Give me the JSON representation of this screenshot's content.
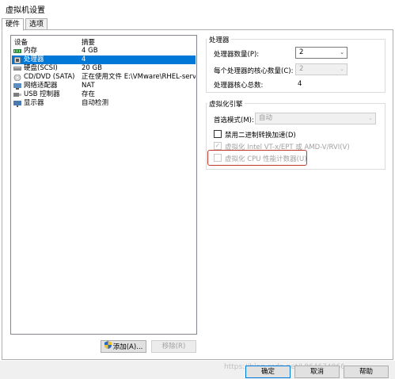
{
  "window": {
    "title": "虚拟机设置"
  },
  "tabs": [
    {
      "label": "硬件",
      "active": true
    },
    {
      "label": "选项",
      "active": false
    }
  ],
  "device_list": {
    "headers": {
      "device": "设备",
      "summary": "摘要"
    },
    "rows": [
      {
        "icon": "memory-icon",
        "name": "内存",
        "value": "4 GB",
        "selected": false
      },
      {
        "icon": "cpu-icon",
        "name": "处理器",
        "value": "4",
        "selected": true
      },
      {
        "icon": "disk-icon",
        "name": "硬盘(SCSI)",
        "value": "20 GB",
        "selected": false
      },
      {
        "icon": "cdrom-icon",
        "name": "CD/DVD (SATA)",
        "value": "正在使用文件 E:\\VMware\\RHEL-serv...",
        "selected": false
      },
      {
        "icon": "network-icon",
        "name": "网络适配器",
        "value": "NAT",
        "selected": false
      },
      {
        "icon": "usb-icon",
        "name": "USB 控制器",
        "value": "存在",
        "selected": false
      },
      {
        "icon": "display-icon",
        "name": "显示器",
        "value": "自动检测",
        "selected": false
      }
    ]
  },
  "device_buttons": {
    "add": "添加(A)...",
    "remove": "移除(R)"
  },
  "processors": {
    "group_title": "处理器",
    "count_label": "处理器数量(P):",
    "count_value": "2",
    "cores_label": "每个处理器的核心数量(C):",
    "cores_value": "2",
    "total_label": "处理器核心总数:",
    "total_value": "4"
  },
  "virtualization": {
    "group_title": "虚拟化引擎",
    "mode_label": "首选模式(M):",
    "mode_value": "自动",
    "opt_binary": "禁用二进制转换加速(D)",
    "opt_vtx": "虚拟化 Intel VT-x/EPT 或 AMD-V/RVI(V)",
    "opt_cpu_counters": "虚拟化 CPU 性能计数器(U)"
  },
  "footer": {
    "ok": "确定",
    "cancel": "取消",
    "help": "帮助",
    "watermark": "https://blog.csdn.net/L864674866"
  },
  "colors": {
    "selection": "#0078d7",
    "highlight_box": "#c0392b"
  }
}
